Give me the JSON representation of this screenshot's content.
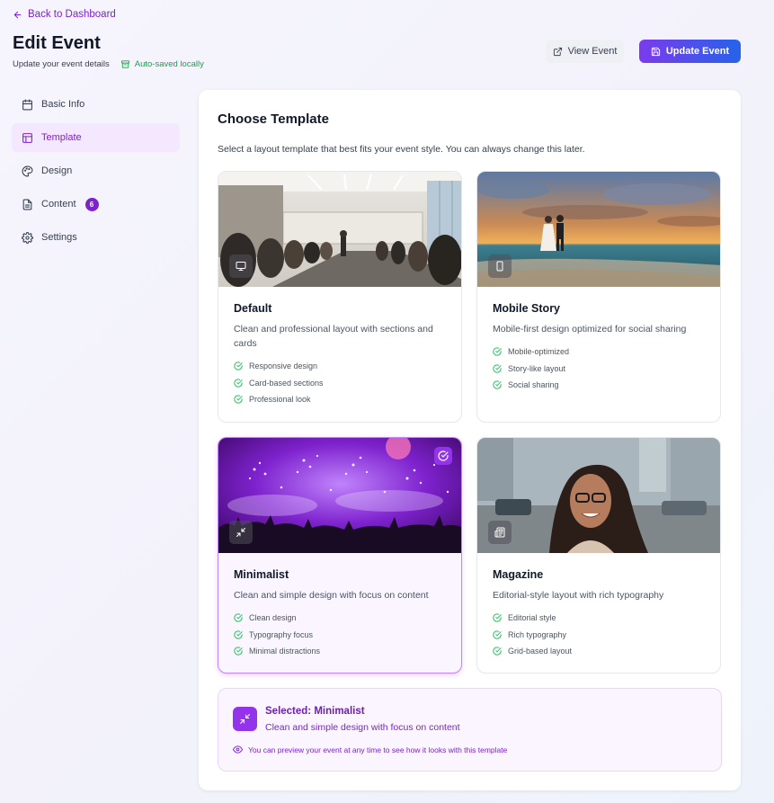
{
  "header": {
    "back_label": "Back to Dashboard",
    "title": "Edit Event",
    "subtitle": "Update your event details",
    "autosave_label": "Auto-saved locally",
    "view_button": "View Event",
    "update_button": "Update Event"
  },
  "sidebar": {
    "items": [
      {
        "label": "Basic Info",
        "icon": "calendar-icon"
      },
      {
        "label": "Template",
        "icon": "layout-icon",
        "active": true
      },
      {
        "label": "Design",
        "icon": "palette-icon"
      },
      {
        "label": "Content",
        "icon": "document-icon",
        "badge": "6"
      },
      {
        "label": "Settings",
        "icon": "gear-icon"
      }
    ]
  },
  "main": {
    "title": "Choose Template",
    "description": "Select a layout template that best fits your event style. You can always change this later.",
    "templates": [
      {
        "name": "Default",
        "description": "Clean and professional layout with sections and cards",
        "icon": "monitor-icon",
        "features": [
          "Responsive design",
          "Card-based sections",
          "Professional look"
        ]
      },
      {
        "name": "Mobile Story",
        "description": "Mobile-first design optimized for social sharing",
        "icon": "smartphone-icon",
        "features": [
          "Mobile-optimized",
          "Story-like layout",
          "Social sharing"
        ]
      },
      {
        "name": "Minimalist",
        "description": "Clean and simple design with focus on content",
        "icon": "minimize-icon",
        "selected": true,
        "features": [
          "Clean design",
          "Typography focus",
          "Minimal distractions"
        ]
      },
      {
        "name": "Magazine",
        "description": "Editorial-style layout with rich typography",
        "icon": "newspaper-icon",
        "features": [
          "Editorial style",
          "Rich typography",
          "Grid-based layout"
        ]
      }
    ],
    "selected_box": {
      "title": "Selected: Minimalist",
      "description": "Clean and simple design with focus on content",
      "tip": "You can preview your event at any time to see how it looks with this template"
    }
  },
  "colors": {
    "accent": "#7e22ce",
    "accent_light": "#f3e8ff",
    "success": "#16a34a",
    "update_gradient_start": "#7c3aed",
    "update_gradient_end": "#2563eb"
  }
}
